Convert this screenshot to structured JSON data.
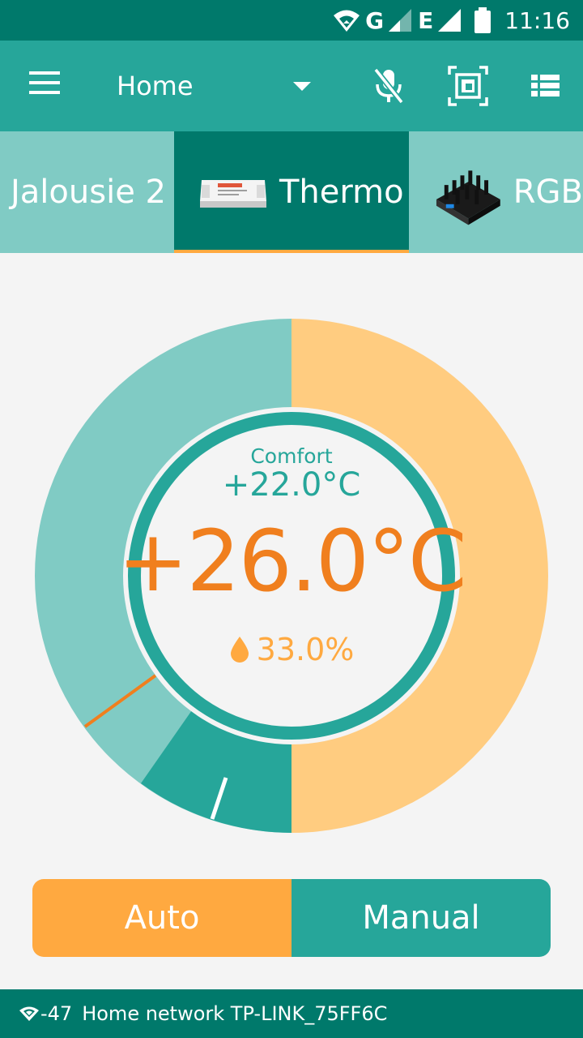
{
  "status_bar": {
    "network_letters": [
      "G",
      "E"
    ],
    "time": "11:16",
    "icons": [
      "wifi-data-icon",
      "signal-icon",
      "signal-icon",
      "battery-icon"
    ]
  },
  "app_bar": {
    "location": "Home",
    "icons": [
      "menu-icon",
      "mic-off-icon",
      "scenes-icon",
      "list-view-icon"
    ]
  },
  "tabs": [
    {
      "label": "Jalousie 2",
      "icon": "",
      "active": false
    },
    {
      "label": "Thermo",
      "icon": "sonoff-device-icon",
      "active": true
    },
    {
      "label": "RGB",
      "icon": "rgb-controller-icon",
      "active": false
    }
  ],
  "thermostat": {
    "mode_name": "Comfort",
    "target_temp": "+22.0°C",
    "current_temp": "+26.0°C",
    "humidity": "33.0%",
    "humidity_icon": "water-drop-icon",
    "colors": {
      "heating_arc": "#ffcc80",
      "cooling_arc": "#80cbc4",
      "active_arc": "#26a69a",
      "current_temp": "#f07f1e",
      "ring": "#26a69a"
    }
  },
  "modes": {
    "auto": "Auto",
    "manual": "Manual",
    "selected": "Auto"
  },
  "footer": {
    "rssi": "-47",
    "network": "Home network TP-LINK_75FF6C",
    "icon": "wifi-icon"
  },
  "colors": {
    "status_bar": "#00796b",
    "app_bar": "#26a69a",
    "tab_strip": "#80cbc4",
    "tab_active": "#00796b",
    "tab_indicator": "#ffa940",
    "auto_button": "#ffa940",
    "manual_button": "#26a69a"
  }
}
